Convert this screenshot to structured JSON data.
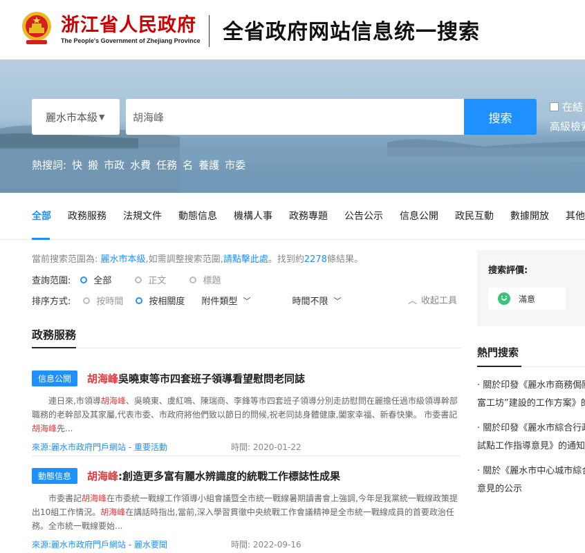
{
  "header": {
    "logo_cn": "浙江省人民政府",
    "logo_en": "The People's Government of Zhejiang Province",
    "title": "全省政府网站信息统一搜索"
  },
  "search": {
    "scope": "麗水市本級",
    "query": "胡海峰",
    "button": "搜索",
    "in_results": "在結",
    "advanced": "高級檢索",
    "hot_label": "熱搜詞:",
    "hot_words": [
      "快",
      "搬",
      "市政",
      "水費",
      "任務",
      "名",
      "養護",
      "市委"
    ]
  },
  "tabs": [
    "全部",
    "政務服務",
    "法規文件",
    "動態信息",
    "機構人事",
    "政務專題",
    "公告公示",
    "信息公開",
    "政民互動",
    "數據開放",
    "其他"
  ],
  "scope_info": {
    "prefix": "當前搜索范圍為:",
    "scope": "麗水市本級",
    "mid": ",如需調整搜索范圍,",
    "link": "請點擊此處",
    "suffix_a": "。找到約",
    "count": "2278",
    "suffix_b": "條結果。"
  },
  "filters": {
    "range_label": "查詢范圍:",
    "range_options": [
      "全部",
      "正文",
      "標題"
    ],
    "sort_label": "排序方式:",
    "sort_options": [
      "按時間",
      "按相關度"
    ],
    "attach_type": "附件類型",
    "time_limit": "時間不限",
    "collapse": "收起工具"
  },
  "section_title": "政務服務",
  "results": [
    {
      "badge": "信息公開",
      "title_kw": "胡海峰",
      "title_rest": "吳曉東等市四套班子領導看望慰問老同誌",
      "snippet_a": "連日來,市領導",
      "snippet_kw1": "胡海峰",
      "snippet_b": "、吳曉東、虞紅鳴、陳瑞商、李鋒等市四套班子領導分別走訪慰問在麗擔任過市級領導幹部職務的老幹部及其家屬,代表市委、市政府將他們致以節日的問候,祝老同誌身體健康,闔家幸福、新春快樂。 市委書記",
      "snippet_kw2": "胡海峰",
      "snippet_c": "先...",
      "source_label": "來源:",
      "source": "麗水市政府門戶網站",
      "source_tail": " - 重要活動",
      "time_label": "時間:",
      "time": "2020-01-22"
    },
    {
      "badge": "動態信息",
      "title_kw": "胡海峰",
      "title_rest": ":創造更多富有麗水辨識度的統戰工作標誌性成果",
      "snippet_a": "市委書記",
      "snippet_kw1": "胡海峰",
      "snippet_b": "在市委統一戰線工作領導小組會議暨全市統一戰線暑期讀書會上強調,今年是我黨統一戰線政策提出10組工作情況。",
      "snippet_kw2": "胡海峰",
      "snippet_c": "在講話時指出,當前,深入學習貫徹中央統戰工作會議精神是全市統一戰線成員的首要政治任務。全市統一戰線要始...",
      "source_label": "來源:",
      "source": "麗水市政府門戶網站",
      "source_tail": " - 麗水要聞",
      "time_label": "時間:",
      "time": "2022-09-16"
    }
  ],
  "evaluation": {
    "title": "搜索評價:",
    "button": "滿意"
  },
  "hot_search": {
    "title": "熱門搜索",
    "items": [
      {
        "line1": "關於印發《麗水市商務侷關",
        "line2": "富工坊”建設的工作方案》的"
      },
      {
        "line1": "關於印發《麗水市綜合行政",
        "line2": "試點工作指導意見》的通知"
      },
      {
        "line1": "關於《麗水市中心城市綜合",
        "line2": "意見的公示"
      }
    ]
  },
  "colors": {
    "accent": "#1e90ff",
    "keyword": "#e4393c",
    "logo_red": "#cc0000"
  }
}
